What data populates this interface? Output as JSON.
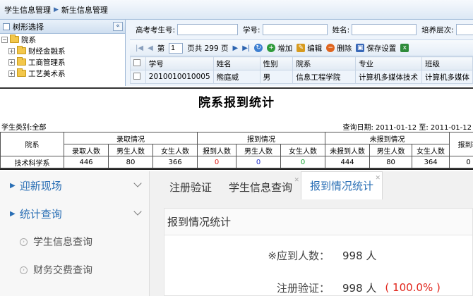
{
  "panel1": {
    "breadcrumb": [
      "学生信息管理",
      "新生信息管理"
    ],
    "tree": {
      "header": "树形选择",
      "root": "院系",
      "items": [
        "财经金融系",
        "工商管理系",
        "工艺美术系"
      ]
    },
    "search": {
      "fields": [
        "高考考生号:",
        "学号:",
        "姓名:",
        "培养层次:"
      ]
    },
    "pager": {
      "page_label": "第",
      "page_value": "1",
      "total": "页共 299 页"
    },
    "toolbar": {
      "add": "增加",
      "edit": "编辑",
      "delete": "删除",
      "save": "保存设置"
    },
    "grid": {
      "columns": [
        "学号",
        "姓名",
        "性别",
        "院系",
        "专业",
        "班级"
      ],
      "rows": [
        [
          "2010010010005",
          "熊庭威",
          "男",
          "信息工程学院",
          "计算机多媒体技术",
          "计算机多媒体"
        ]
      ]
    }
  },
  "panel2": {
    "title": "院系报到统计",
    "student_type": "学生类别:全部",
    "query_date": "查询日期:  2011-01-12   至:  2011-01-12",
    "headers": {
      "dept": "院系",
      "admitted": "录取情况",
      "reported": "报到情况",
      "not_reported": "未报到情况",
      "rate": "报到率",
      "sub": [
        "录取人数",
        "男生人数",
        "女生人数",
        "报到人数",
        "男生人数",
        "女生人数",
        "未报到人数",
        "男生人数",
        "女生人数"
      ]
    },
    "row": {
      "dept": "技术科学系",
      "values": [
        "446",
        "80",
        "366",
        "0",
        "0",
        "0",
        "444",
        "80",
        "364",
        "0"
      ]
    },
    "colors": {
      "reported_0": "#e0201a",
      "reported_1": "#1f2fc9",
      "reported_2": "#14a532"
    }
  },
  "panel3": {
    "menu": {
      "items": [
        "迎新现场",
        "统计查询"
      ],
      "sub_items": [
        "学生信息查询",
        "财务交费查询"
      ]
    },
    "tabs": [
      "注册验证",
      "学生信息查询",
      "报到情况统计"
    ],
    "content_title": "报到情况统计",
    "stats": [
      {
        "label": "※应到人数：",
        "value": "998 人",
        "pct": ""
      },
      {
        "label": "注册验证：",
        "value": "998 人",
        "pct": "( 100.0% )"
      }
    ]
  }
}
